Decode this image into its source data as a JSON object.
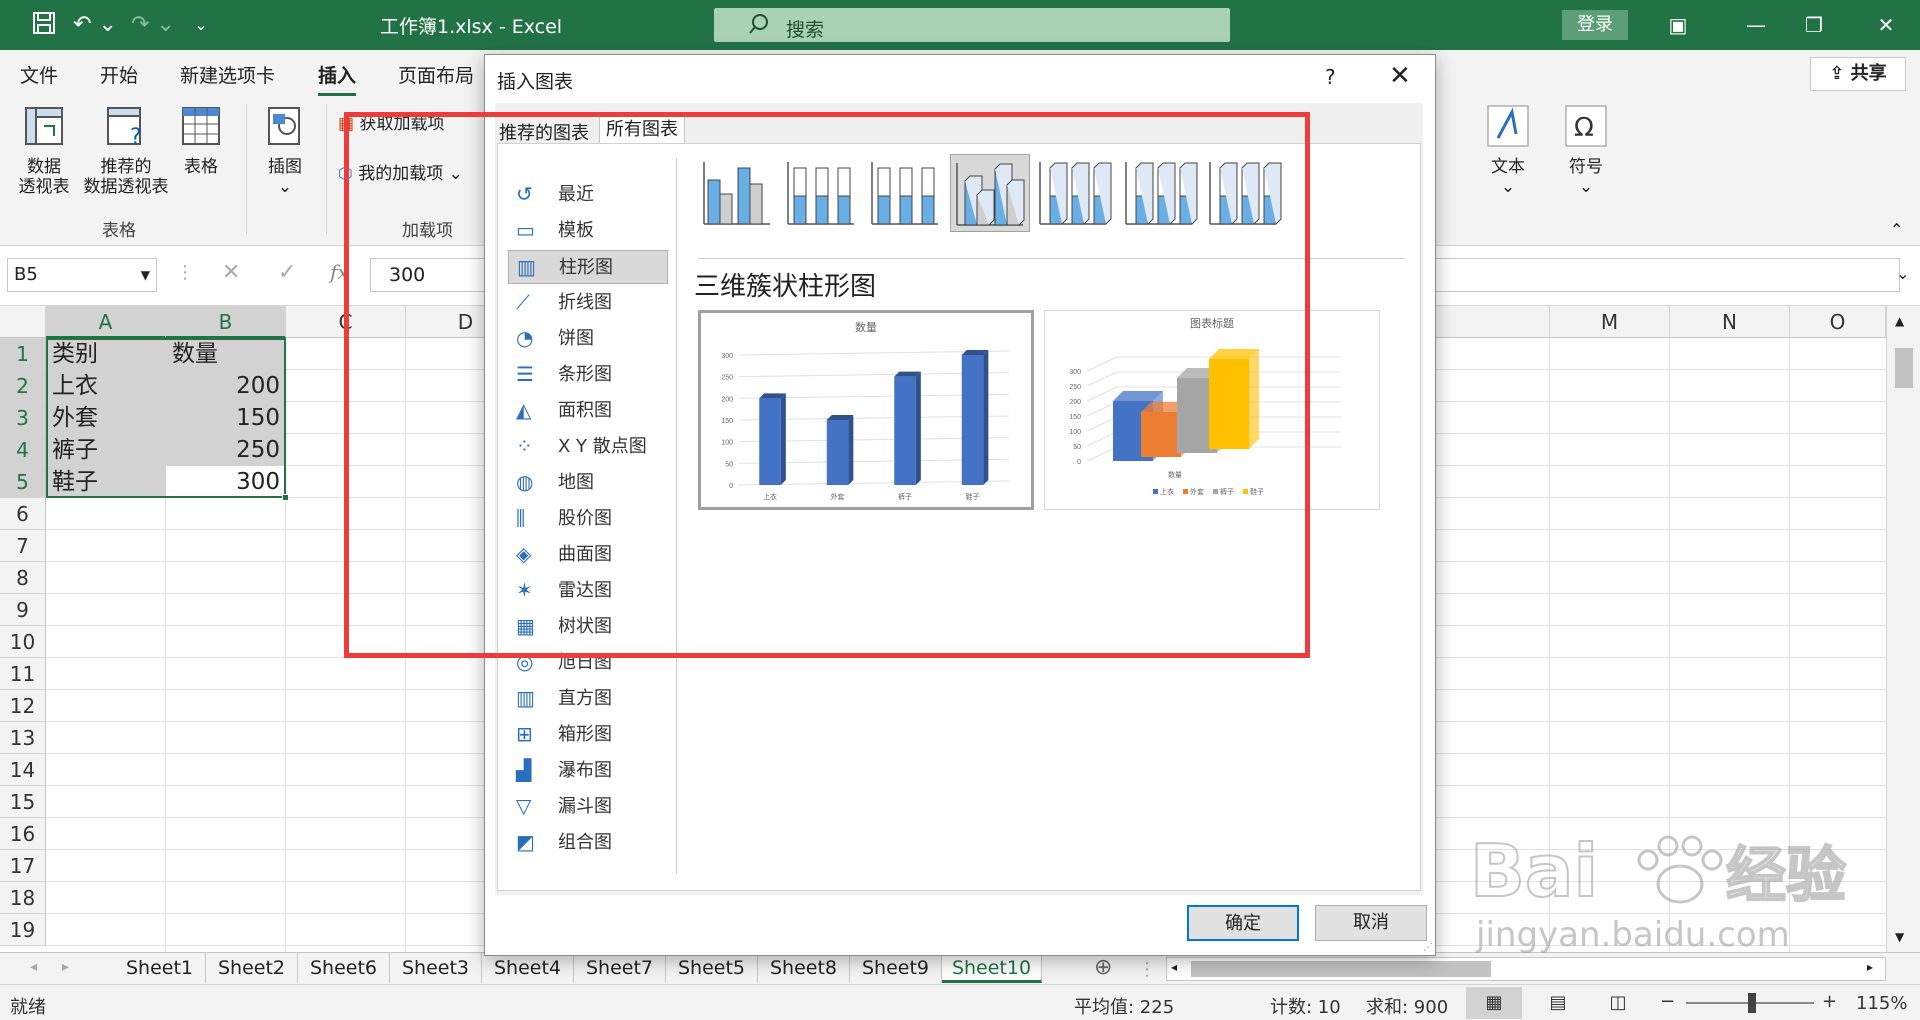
{
  "titlebar": {
    "doc_title": "工作簿1.xlsx  -  Excel",
    "search_placeholder": "搜索",
    "login": "登录",
    "share": "共享"
  },
  "tabs": [
    "文件",
    "开始",
    "新建选项卡",
    "插入",
    "页面布局"
  ],
  "active_tab": "插入",
  "ribbon": {
    "pivot": "数据\n透视表",
    "pivot_line1": "数据",
    "pivot_line2": "透视表",
    "rec_pivot_line1": "推荐的",
    "rec_pivot_line2": "数据透视表",
    "table": "表格",
    "illustrations": "插图",
    "group_tables": "表格",
    "get_addins": "获取加载项",
    "my_addins": "我的加载项",
    "group_addins": "加载项",
    "text": "文本",
    "symbol": "符号"
  },
  "formula_bar": {
    "name_box": "B5",
    "fx": "fx",
    "value": "300"
  },
  "columns": [
    "A",
    "B",
    "C",
    "D",
    "M",
    "N",
    "O"
  ],
  "rows": [
    "1",
    "2",
    "3",
    "4",
    "5",
    "6",
    "7",
    "8",
    "9",
    "10",
    "11",
    "12",
    "13",
    "14",
    "15",
    "16",
    "17",
    "18",
    "19"
  ],
  "cells": [
    {
      "a": "类别",
      "b": "数量"
    },
    {
      "a": "上衣",
      "b": "200"
    },
    {
      "a": "外套",
      "b": "150"
    },
    {
      "a": "裤子",
      "b": "250"
    },
    {
      "a": "鞋子",
      "b": "300"
    }
  ],
  "sheets": [
    "Sheet1",
    "Sheet2",
    "Sheet6",
    "Sheet3",
    "Sheet4",
    "Sheet7",
    "Sheet5",
    "Sheet8",
    "Sheet9",
    "Sheet10"
  ],
  "active_sheet": "Sheet10",
  "status": {
    "ready": "就绪",
    "average": "平均值: 225",
    "count": "计数: 10",
    "sum": "求和: 900",
    "zoom": "115%"
  },
  "dialog": {
    "title": "插入图表",
    "help": "?",
    "tab_recommended": "推荐的图表",
    "tab_all": "所有图表",
    "categories": [
      "最近",
      "模板",
      "柱形图",
      "折线图",
      "饼图",
      "条形图",
      "面积图",
      "X Y 散点图",
      "地图",
      "股价图",
      "曲面图",
      "雷达图",
      "树状图",
      "旭日图",
      "直方图",
      "箱形图",
      "瀑布图",
      "漏斗图",
      "组合图"
    ],
    "selected_category": "柱形图",
    "chart_type_title": "三维簇状柱形图",
    "ok": "确定",
    "cancel": "取消"
  },
  "chart_data": [
    {
      "type": "bar",
      "title": "数量",
      "categories": [
        "上衣",
        "外套",
        "裤子",
        "鞋子"
      ],
      "values": [
        200,
        150,
        250,
        300
      ],
      "ylim": [
        0,
        300
      ],
      "yticks": [
        0,
        50,
        100,
        150,
        200,
        250,
        300
      ],
      "color": "#4472c4"
    },
    {
      "type": "bar",
      "title": "图表标题",
      "xlabel": "数量",
      "categories": [
        "数量"
      ],
      "series": [
        {
          "name": "上衣",
          "values": [
            200
          ]
        },
        {
          "name": "外套",
          "values": [
            150
          ]
        },
        {
          "name": "裤子",
          "values": [
            250
          ]
        },
        {
          "name": "鞋子",
          "values": [
            300
          ]
        }
      ],
      "colors": [
        "#4472c4",
        "#ed7d31",
        "#a5a5a5",
        "#ffc000"
      ],
      "ylim": [
        0,
        300
      ],
      "yticks": [
        0,
        50,
        100,
        150,
        200,
        250,
        300
      ]
    }
  ],
  "colors": {
    "excel_green": "#217346",
    "highlight_red": "#ee3b3b"
  }
}
